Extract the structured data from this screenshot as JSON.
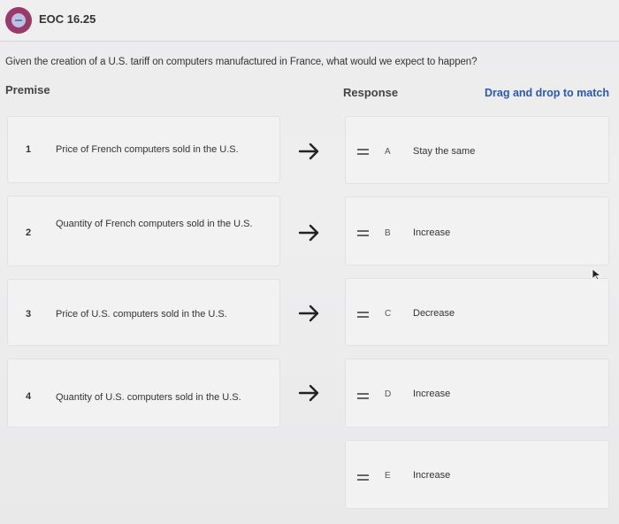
{
  "header": {
    "title": "EOC 16.25",
    "logo_icon": "app-logo-icon"
  },
  "question": "Given the creation of a U.S. tariff on computers manufactured in France, what would we expect to happen?",
  "columns": {
    "premise": "Premise",
    "response": "Response",
    "drag_hint": "Drag and drop to match"
  },
  "premises": [
    {
      "number": "1",
      "text": "Price of French computers sold in the U.S."
    },
    {
      "number": "2",
      "text": "Quantity of French computers sold in the U.S."
    },
    {
      "number": "3",
      "text": "Price of U.S. computers sold in the U.S."
    },
    {
      "number": "4",
      "text": "Quantity of U.S. computers sold in the U.S."
    }
  ],
  "responses": [
    {
      "letter": "A",
      "text": "Stay the same"
    },
    {
      "letter": "B",
      "text": "Increase"
    },
    {
      "letter": "C",
      "text": "Decrease"
    },
    {
      "letter": "D",
      "text": "Increase"
    },
    {
      "letter": "E",
      "text": "Increase"
    }
  ],
  "colors": {
    "accent_link": "#2b58b8",
    "logo": "#9b3a6a"
  }
}
